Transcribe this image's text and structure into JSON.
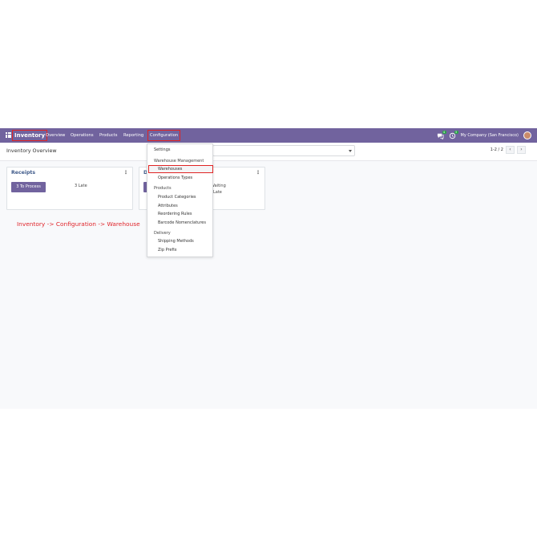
{
  "navbar": {
    "app_name": "Inventory",
    "menu": [
      "Overview",
      "Operations",
      "Products",
      "Reporting",
      "Configuration"
    ],
    "messages_badge": "4",
    "activities_badge": "3",
    "company": "My Company (San Francisco)",
    "bg_color": "#71639e"
  },
  "control_panel": {
    "title": "Inventory Overview",
    "pager": "1-2 / 2",
    "prev_icon": "chevron-left-icon",
    "next_icon": "chevron-right-icon"
  },
  "cards": [
    {
      "title": "Receipts",
      "button": "3 To Process",
      "stat1": "3 Late",
      "stat2": ""
    },
    {
      "title": "D",
      "button": "",
      "stat1": "Waiting",
      "stat2": "Late"
    }
  ],
  "annotation": "Inventory -> Configuration -> Warehouse",
  "dropdown": {
    "rows": [
      {
        "label": "Settings",
        "kind": "item0"
      },
      {
        "label": "Warehouse Management",
        "kind": "header"
      },
      {
        "label": "Warehouses",
        "kind": "selected"
      },
      {
        "label": "Operations Types",
        "kind": "item"
      },
      {
        "label": "Products",
        "kind": "header"
      },
      {
        "label": "Product Categories",
        "kind": "item"
      },
      {
        "label": "Attributes",
        "kind": "item"
      },
      {
        "label": "Reordering Rules",
        "kind": "item"
      },
      {
        "label": "Barcode Nomenclatures",
        "kind": "item"
      },
      {
        "label": "Delivery",
        "kind": "header"
      },
      {
        "label": "Shipping Methods",
        "kind": "item"
      },
      {
        "label": "Zip Prefix",
        "kind": "item"
      }
    ]
  },
  "highlight_color": "#e02424",
  "annotation_color": "#e0242a"
}
